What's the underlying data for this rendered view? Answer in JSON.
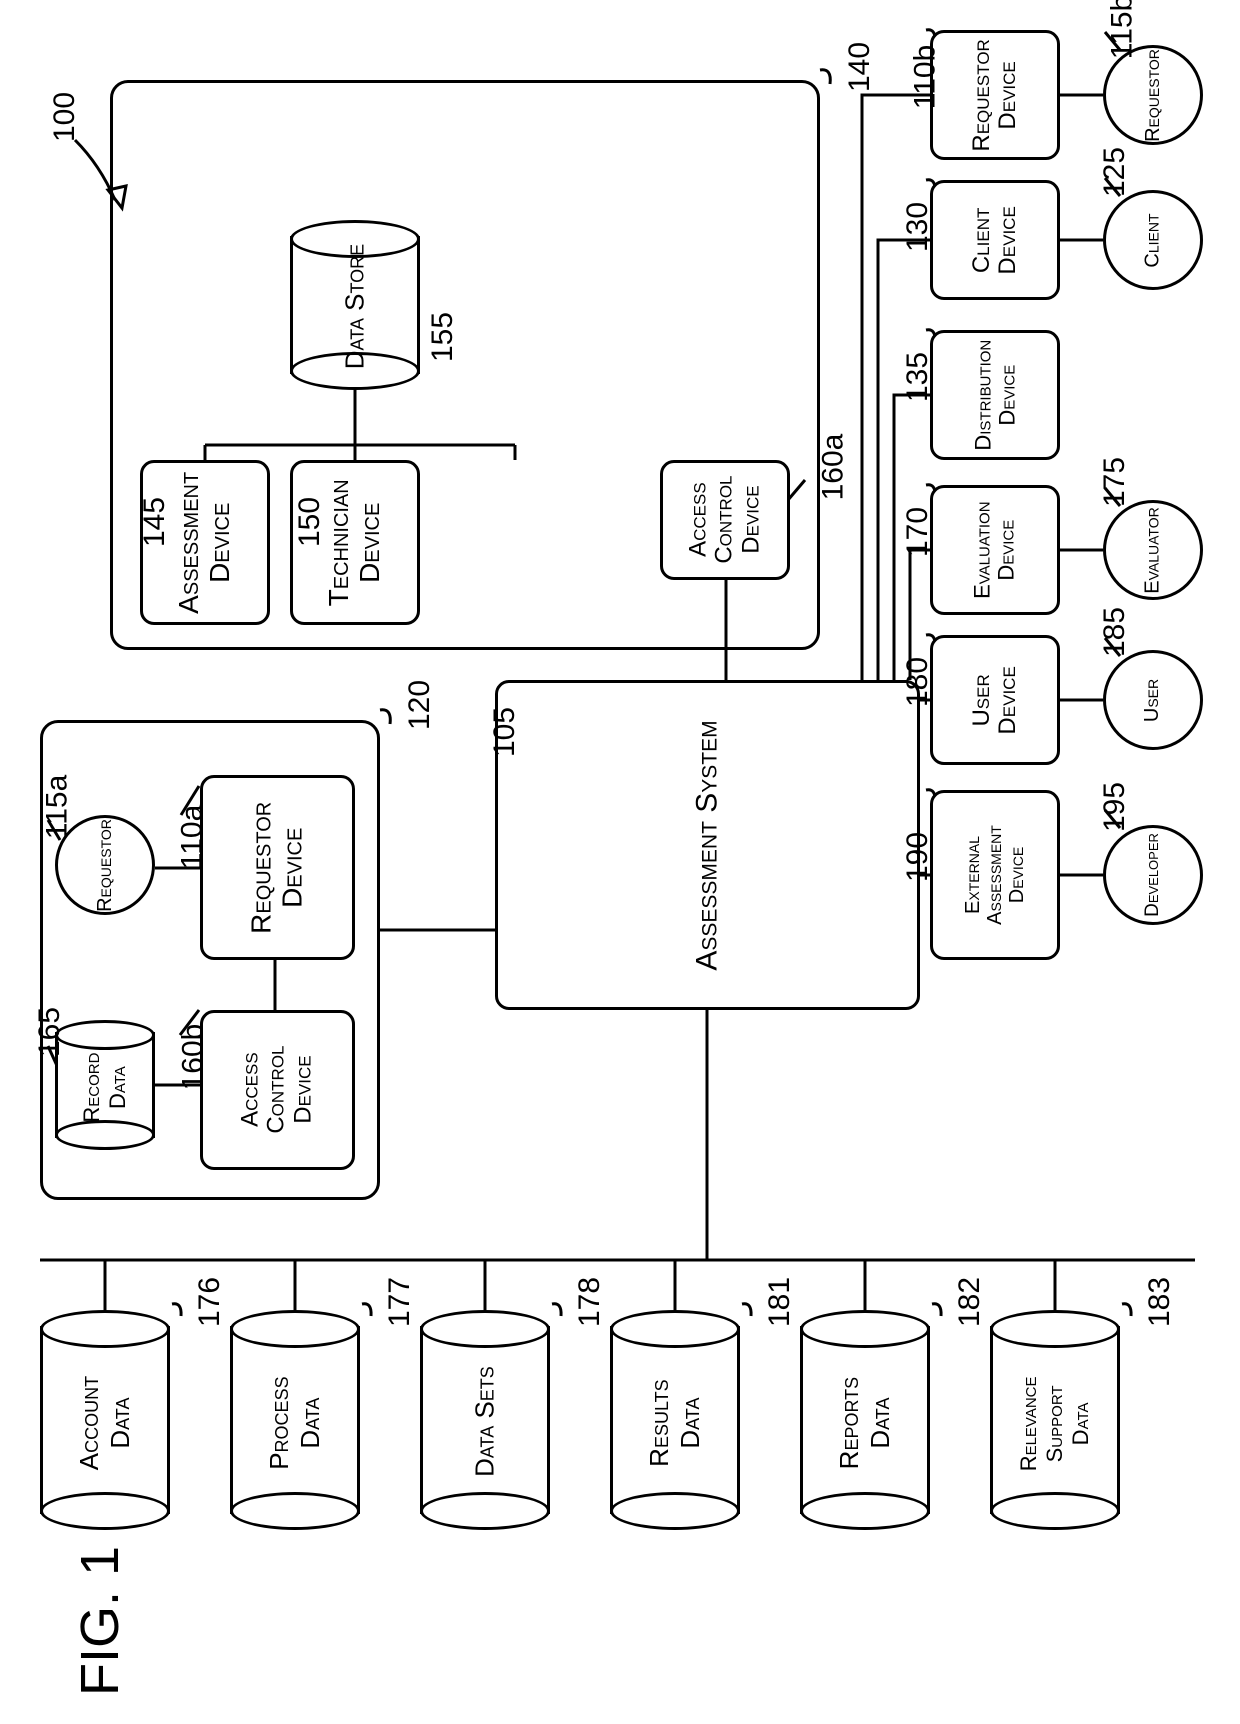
{
  "fig": "FIG. 1",
  "overall_ref": "100",
  "frames": {
    "top_ref": "140",
    "lower_ref": "120"
  },
  "top": {
    "assessment_device": "Assessment\nDevice",
    "assessment_device_ref": "145",
    "technician_device": "Technician\nDevice",
    "technician_device_ref": "150",
    "access_control_device": "Access\nControl\nDevice",
    "access_control_device_ref": "160a",
    "data_store": "Data Store",
    "data_store_ref": "155"
  },
  "center": {
    "assessment_system": "Assessment System",
    "assessment_system_ref": "105"
  },
  "left_lower": {
    "frame_ref": "120",
    "requestor_circle": "Requestor",
    "requestor_circle_ref": "115a",
    "requestor_device": "Requestor\nDevice",
    "requestor_device_ref": "110a",
    "record_data": "Record\nData",
    "record_data_ref": "165",
    "access_control_device": "Access\nControl\nDevice",
    "access_control_device_ref": "160b"
  },
  "right_col": {
    "requestor_device": "Requestor\nDevice",
    "requestor_device_ref": "110b",
    "requestor_circle": "Requestor",
    "requestor_circle_ref": "115b",
    "client_device": "Client\nDevice",
    "client_device_ref": "130",
    "client_circle": "Client",
    "client_circle_ref": "125",
    "distribution_device": "Distribution\nDevice",
    "distribution_device_ref": "135",
    "evaluation_device": "Evaluation\nDevice",
    "evaluation_device_ref": "170",
    "evaluator_circle": "Evaluator",
    "evaluator_circle_ref": "175",
    "user_device": "User\nDevice",
    "user_device_ref": "180",
    "user_circle": "User",
    "user_circle_ref": "185",
    "external_assessment_device": "External\nAssessment\nDevice",
    "external_assessment_device_ref": "190",
    "developer_circle": "Developer",
    "developer_circle_ref": "195"
  },
  "bottom_dbs": {
    "account_data": "Account\nData",
    "account_data_ref": "176",
    "process_data": "Process\nData",
    "process_data_ref": "177",
    "data_sets": "Data Sets",
    "data_sets_ref": "178",
    "results_data": "Results\nData",
    "results_data_ref": "181",
    "reports_data": "Reports\nData",
    "reports_data_ref": "182",
    "relevance_support_data": "Relevance\nSupport\nData",
    "relevance_support_data_ref": "183"
  }
}
